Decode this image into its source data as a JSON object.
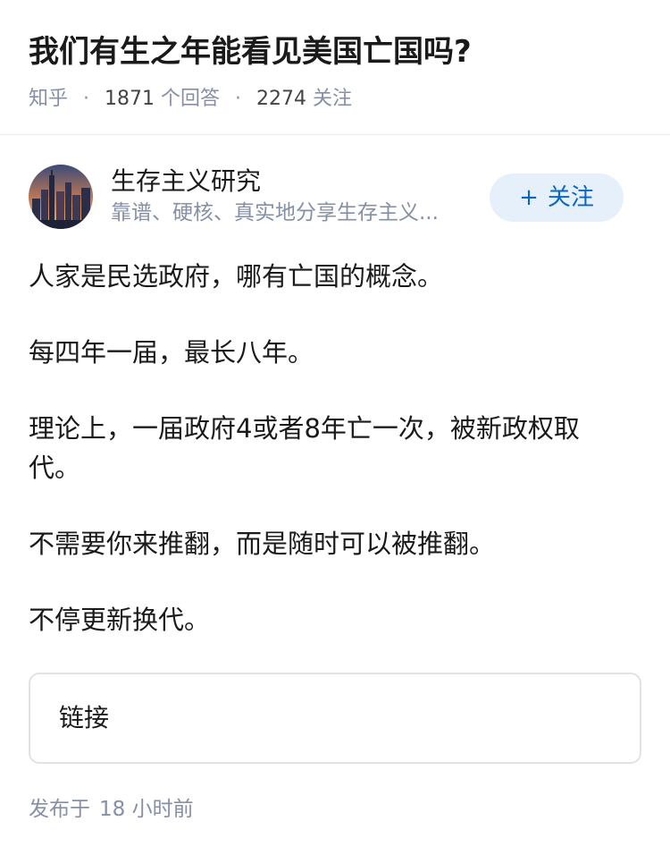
{
  "question": {
    "title": "我们有生之年能看见美国亡国吗?",
    "source": "知乎",
    "answer_count": "1871",
    "answer_label": "个回答",
    "follow_count": "2274",
    "follow_label": "关注"
  },
  "author": {
    "name": "生存主义研究",
    "bio": "靠谱、硬核、真实地分享生存主义...",
    "follow_button": "关注",
    "follow_icon": "+"
  },
  "answer": {
    "paragraphs": [
      "人家是民选政府，哪有亡国的概念。",
      "每四年一届，最长八年。",
      "理论上，一届政府4或者8年亡一次，被新政权取代。",
      "不需要你来推翻，而是随时可以被推翻。",
      "不停更新换代。"
    ]
  },
  "link_card": {
    "label": "链接"
  },
  "publish": {
    "label": "发布于",
    "time": "18 小时前"
  },
  "colors": {
    "accent": "#0a66c2",
    "follow_bg": "#e6f0fb",
    "meta": "#8590a6"
  },
  "icons": {
    "avatar": "city-skyline-avatar"
  }
}
